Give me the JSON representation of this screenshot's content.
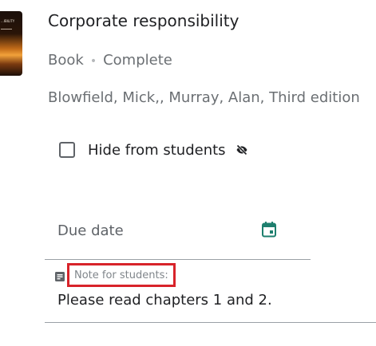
{
  "book": {
    "cover_text": "...IBILITY",
    "title": "Corporate responsibility",
    "type": "Book",
    "status": "Complete",
    "separator": "•",
    "authors": "Blowfield, Mick,, Murray, Alan, Third edition"
  },
  "hide": {
    "label": "Hide from students",
    "checked": false,
    "icon": "eye-off-icon"
  },
  "due": {
    "label": "Due date",
    "icon": "calendar-icon",
    "icon_color": "#1e7f6e"
  },
  "note": {
    "label": "Note for students:",
    "value": "Please read chapters 1 and 2.",
    "icon": "note-icon",
    "highlight_color": "#d8232a"
  }
}
